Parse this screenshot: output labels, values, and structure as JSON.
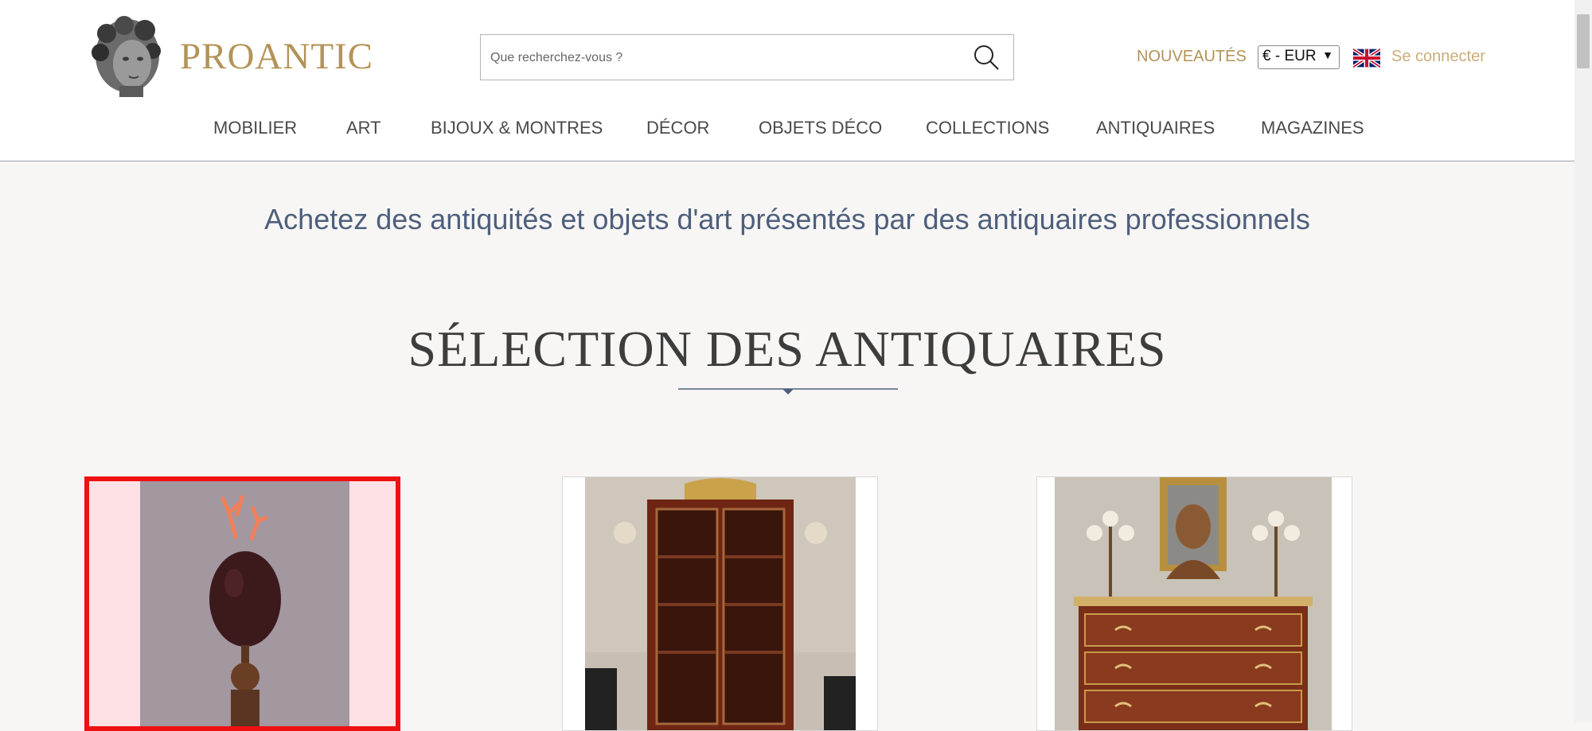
{
  "brand": {
    "name": "PROANTIC"
  },
  "search": {
    "placeholder": "Que recherchez-vous ?"
  },
  "header": {
    "new_label": "NOUVEAUTÉS",
    "currency": "€ - EUR",
    "signin_label": "Se connecter",
    "language_icon": "uk-flag-icon"
  },
  "nav": {
    "items": [
      {
        "label": "MOBILIER"
      },
      {
        "label": "ART"
      },
      {
        "label": "BIJOUX & MONTRES"
      },
      {
        "label": "DÉCOR"
      },
      {
        "label": "OBJETS DÉCO"
      },
      {
        "label": "COLLECTIONS"
      },
      {
        "label": "ANTIQUAIRES"
      },
      {
        "label": "MAGAZINES"
      }
    ]
  },
  "main": {
    "tagline": "Achetez des antiquités et objets d'art présentés par des antiquaires professionnels",
    "section_title": "SÉLECTION DES ANTIQUAIRES"
  },
  "colors": {
    "gold": "#b39357",
    "nav_text": "#4a4a4a",
    "tagline": "#4e5f7c",
    "selection_border": "#ee1111"
  }
}
